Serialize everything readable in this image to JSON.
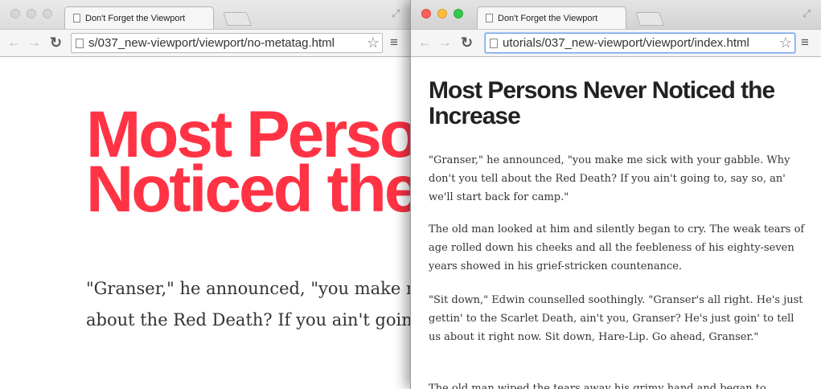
{
  "left_window": {
    "tab_title": "Don't Forget the Viewport",
    "url": "s/037_new-viewport/viewport/no-metatag.html",
    "heading": "Most Persons Never Noticed the Increase",
    "paragraph": "\"Granser,\" he announced, \"you make me sick with your gabble. Why don't you tell about the Red Death? If you ain't going to, say so, an' we'll start back for camp.\""
  },
  "right_window": {
    "tab_title": "Don't Forget the Viewport",
    "url": "utorials/037_new-viewport/viewport/index.html",
    "heading": "Most Persons Never Noticed the Increase",
    "paragraphs": [
      "\"Granser,\" he announced, \"you make me sick with your gabble. Why don't you tell about the Red Death? If you ain't going to, say so, an' we'll start back for camp.\"",
      "The old man looked at him and silently began to cry. The weak tears of age rolled down his cheeks and all the feebleness of his eighty-seven years showed in his grief-stricken countenance.",
      "\"Sit down,\" Edwin counselled soothingly. \"Granser's all right. He's just gettin' to the Scarlet Death, ain't you, Granser? He's just goin' to tell us about it right now. Sit down, Hare-Lip. Go ahead, Granser.\"",
      "The old man wiped the tears away his grimy hand and began to"
    ]
  },
  "icons": {
    "back": "back-arrow-icon",
    "forward": "forward-arrow-icon",
    "reload": "reload-icon",
    "page": "document-icon",
    "bookmark": "star-icon",
    "menu": "hamburger-menu-icon",
    "fullscreen": "fullscreen-icon"
  },
  "colors": {
    "left_heading": "#ff3344",
    "close": "#fc605b",
    "minimize": "#fdbc40",
    "zoom": "#34c84a"
  }
}
